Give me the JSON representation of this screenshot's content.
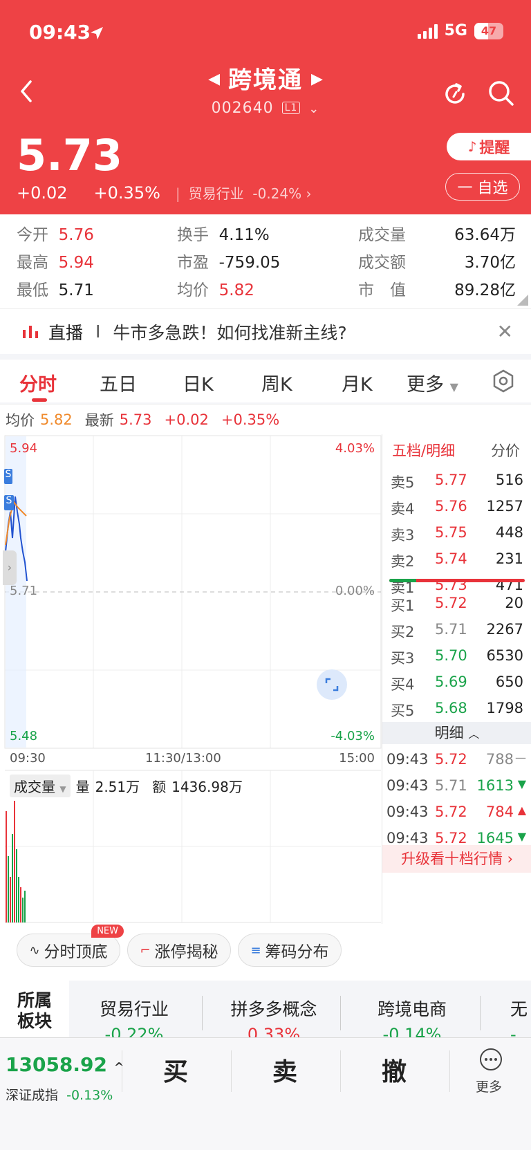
{
  "status": {
    "time": "09:43",
    "network": "5G",
    "battery": "47"
  },
  "header": {
    "title": "跨境通",
    "code": "002640",
    "level": "L1",
    "price": "5.73",
    "change": "+0.02",
    "change_pct": "+0.35%",
    "industry_label": "贸易行业",
    "industry_pct": "-0.24%",
    "remind_label": "提醒",
    "fav_label": "一 自选"
  },
  "stats": {
    "open_k": "今开",
    "open_v": "5.76",
    "high_k": "最高",
    "high_v": "5.94",
    "low_k": "最低",
    "low_v": "5.71",
    "turnover_k": "换手",
    "turnover_v": "4.11%",
    "pe_k": "市盈",
    "pe_v": "-759.05",
    "avg_k": "均价",
    "avg_v": "5.82",
    "volume_k": "成交量",
    "volume_v": "63.64万",
    "amount_k": "成交额",
    "amount_v": "3.70亿",
    "mcap_k": "市　值",
    "mcap_v": "89.28亿"
  },
  "news": {
    "tag": "直播",
    "sep": "I",
    "text": "牛市多急跌！如何找准新主线?"
  },
  "tabs": [
    "分时",
    "五日",
    "日K",
    "周K",
    "月K",
    "更多"
  ],
  "avgrow": {
    "avg_k": "均价",
    "avg_v": "5.82",
    "latest_k": "最新",
    "latest_v": "5.73",
    "chg": "+0.02",
    "chg_pct": "+0.35%"
  },
  "chart": {
    "y_high": "5.94",
    "y_mid": "5.71",
    "y_low": "5.48",
    "pct_high": "4.03%",
    "pct_mid": "0.00%",
    "pct_low": "-4.03%",
    "x_start": "09:30",
    "x_mid": "11:30/13:00",
    "x_end": "15:00",
    "vol_label": "成交量",
    "vol_k": "量",
    "vol_v": "2.51万",
    "amt_k": "额",
    "amt_v": "1436.98万",
    "marker": "S"
  },
  "orderbook": {
    "tab_active": "五档/明细",
    "tab_other": "分价",
    "asks": [
      {
        "k": "卖5",
        "p": "5.77",
        "q": "516"
      },
      {
        "k": "卖4",
        "p": "5.76",
        "q": "1257"
      },
      {
        "k": "卖3",
        "p": "5.75",
        "q": "448"
      },
      {
        "k": "卖2",
        "p": "5.74",
        "q": "231"
      },
      {
        "k": "卖1",
        "p": "5.73",
        "q": "471"
      }
    ],
    "bids": [
      {
        "k": "买1",
        "p": "5.72",
        "q": "20"
      },
      {
        "k": "买2",
        "p": "5.71",
        "q": "2267"
      },
      {
        "k": "买3",
        "p": "5.70",
        "q": "6530"
      },
      {
        "k": "买4",
        "p": "5.69",
        "q": "650"
      },
      {
        "k": "买5",
        "p": "5.68",
        "q": "1798"
      }
    ],
    "detail_label": "明细",
    "ticks": [
      {
        "t": "09:43",
        "p": "5.72",
        "q": "788",
        "dir": "—"
      },
      {
        "t": "09:43",
        "p": "5.71",
        "q": "1613",
        "dir": "▼"
      },
      {
        "t": "09:43",
        "p": "5.72",
        "q": "784",
        "dir": "▲"
      },
      {
        "t": "09:43",
        "p": "5.72",
        "q": "1645",
        "dir": "▼"
      }
    ],
    "upgrade": "升级看十档行情"
  },
  "tools": {
    "t1": "分时顶底",
    "t1_badge": "NEW",
    "t2": "涨停揭秘",
    "t3": "筹码分布"
  },
  "sectors": {
    "title": "所属板块",
    "items": [
      {
        "name": "贸易行业",
        "pct": "-0.22%"
      },
      {
        "name": "拼多多概念",
        "pct": "0.33%"
      },
      {
        "name": "跨境电商",
        "pct": "-0.14%"
      },
      {
        "name": "无",
        "pct": "-"
      }
    ]
  },
  "bottom": {
    "index_v": "13058.92",
    "index_name": "深证成指",
    "index_pct": "-0.13%",
    "buy": "买",
    "sell": "卖",
    "cancel": "撤",
    "more": "更多"
  },
  "colors": {
    "up": "#e8333a",
    "down": "#1aa34a",
    "header": "#ee4245"
  }
}
